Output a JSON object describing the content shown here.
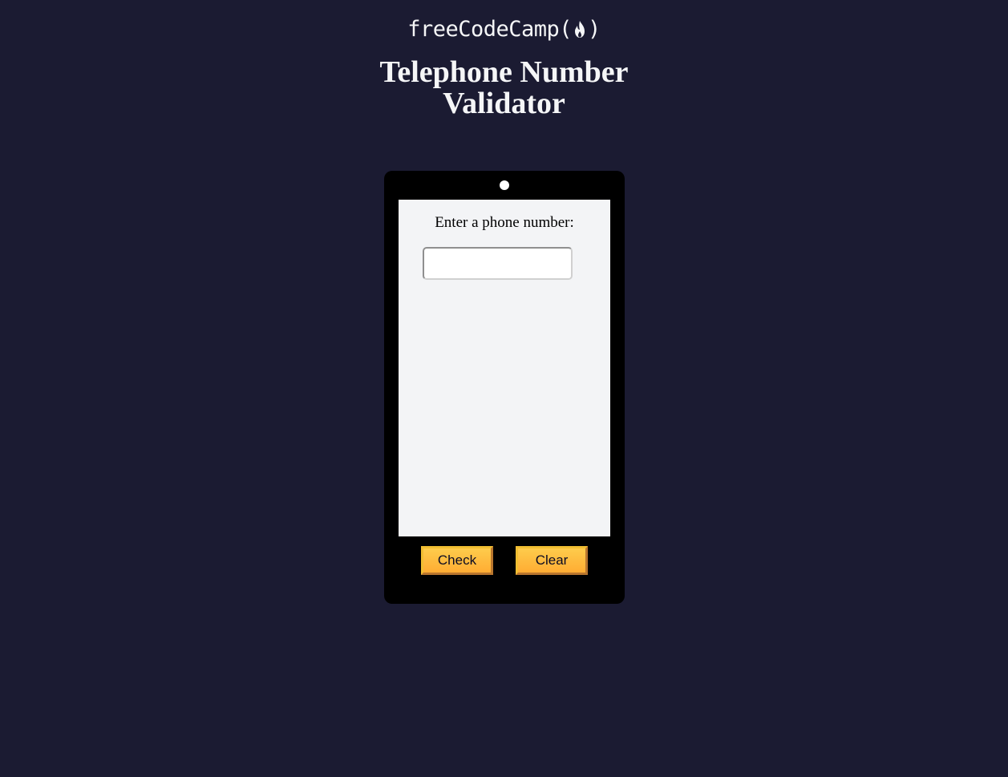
{
  "header": {
    "logo_prefix": "freeCodeCamp(",
    "logo_suffix": ")",
    "logo_icon": "flame-icon"
  },
  "page": {
    "title_line1": "Telephone Number",
    "title_line2": "Validator"
  },
  "phone": {
    "prompt": "Enter a phone number:",
    "input_value": "",
    "check_label": "Check",
    "clear_label": "Clear"
  },
  "colors": {
    "background": "#1b1b32",
    "text_light": "#f5f6f7",
    "phone_body": "#000000",
    "screen": "#f3f4f6",
    "button_gradient_top": "#fecc4c",
    "button_gradient_bottom": "#ffac33",
    "button_text": "#0a0a23"
  }
}
